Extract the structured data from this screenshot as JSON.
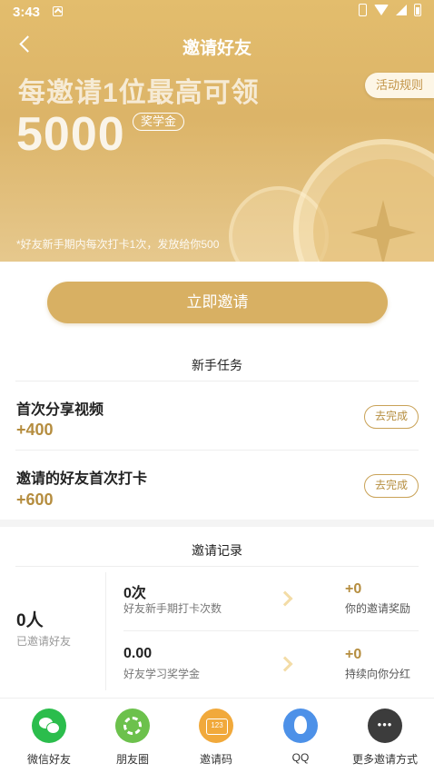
{
  "status_bar": {
    "time": "3:43"
  },
  "header": {
    "title": "邀请好友",
    "headline": "每邀请1位最高可领",
    "amount": "5000",
    "badge": "奖学金",
    "rules_button": "活动规则",
    "note": "*好友新手期内每次打卡1次，发放给你500"
  },
  "invite_button": "立即邀请",
  "tasks": {
    "title": "新手任务",
    "items": [
      {
        "name": "首次分享视频",
        "points": "+400",
        "action": "去完成"
      },
      {
        "name": "邀请的好友首次打卡",
        "points": "+600",
        "action": "去完成"
      }
    ]
  },
  "records": {
    "title": "邀请记录",
    "invited_count": "0人",
    "invited_label": "已邀请好友",
    "rows": [
      {
        "value": "0次",
        "label": "好友新手期打卡次数",
        "reward": "+0",
        "reward_label": "你的邀请奖励"
      },
      {
        "value": "0.00",
        "label": "好友学习奖学金",
        "reward": "+0",
        "reward_label": "持续向你分红"
      }
    ]
  },
  "share_bar": {
    "items": [
      {
        "label": "微信好友",
        "icon": "wechat-icon",
        "color": "#2bbd4c"
      },
      {
        "label": "朋友圈",
        "icon": "moments-icon",
        "color": "#6cc14c"
      },
      {
        "label": "邀请码",
        "icon": "invite-code-icon",
        "color": "#f1a93b"
      },
      {
        "label": "QQ",
        "icon": "qq-icon",
        "color": "#4d91e8"
      },
      {
        "label": "更多邀请方式",
        "icon": "more-icon",
        "color": "#3c3c3c"
      }
    ]
  },
  "colors": {
    "gold": "#d8b063",
    "gold_text": "#b58d3f"
  }
}
